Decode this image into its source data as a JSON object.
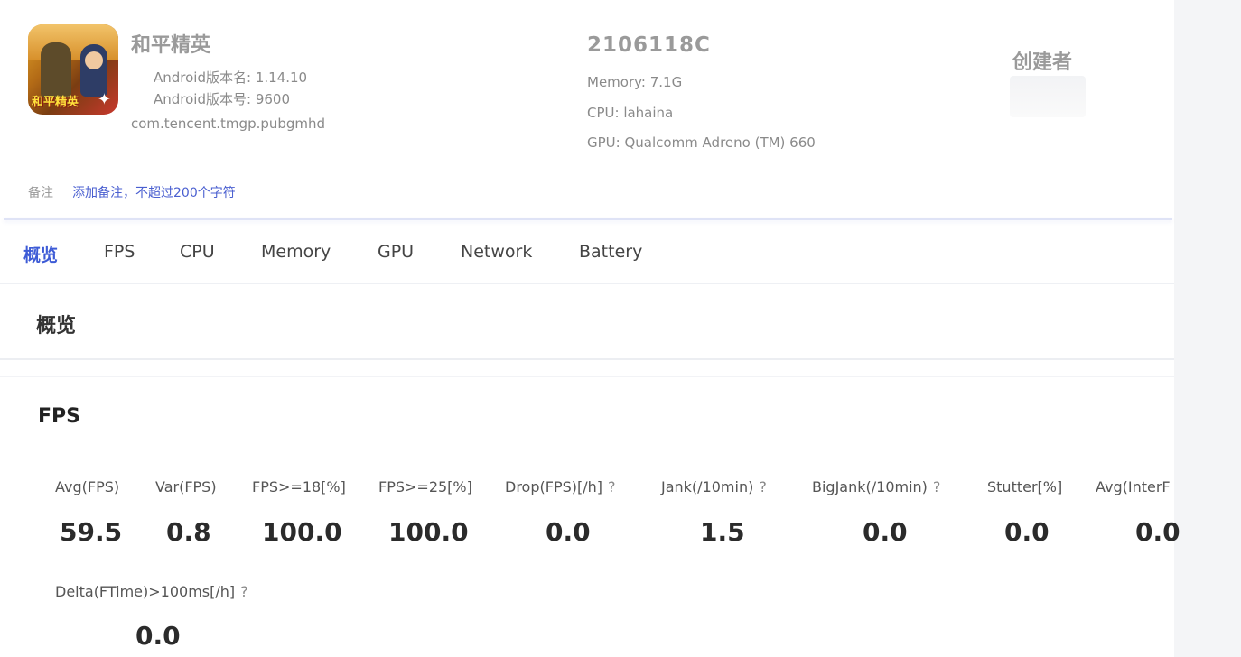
{
  "app": {
    "name": "和平精英",
    "version_name": "Android版本名: 1.14.10",
    "version_code": "Android版本号: 9600",
    "package": "com.tencent.tmgp.pubgmhd",
    "icon_badge": "和平精英"
  },
  "device": {
    "model": "2106118C",
    "memory": "Memory: 7.1G",
    "cpu": "CPU: lahaina",
    "gpu": "GPU: Qualcomm Adreno (TM) 660"
  },
  "creator": {
    "label": "创建者"
  },
  "remark": {
    "label": "备注",
    "link": "添加备注，不超过200个字符"
  },
  "tabs": [
    "概览",
    "FPS",
    "CPU",
    "Memory",
    "GPU",
    "Network",
    "Battery"
  ],
  "active_tab": "概览",
  "overview": {
    "title": "概览"
  },
  "fps": {
    "title": "FPS",
    "help_symbol": "?",
    "metrics": [
      {
        "label": "Avg(FPS)",
        "value": "59.5"
      },
      {
        "label": "Var(FPS)",
        "value": "0.8"
      },
      {
        "label": "FPS>=18[%]",
        "value": "100.0"
      },
      {
        "label": "FPS>=25[%]",
        "value": "100.0"
      },
      {
        "label": "Drop(FPS)[/h]",
        "value": "0.0"
      },
      {
        "label": "Jank(/10min)",
        "value": "1.5"
      },
      {
        "label": "BigJank(/10min)",
        "value": "0.0"
      },
      {
        "label": "Stutter[%]",
        "value": "0.0"
      },
      {
        "label": "Avg(InterF",
        "value": "0.0"
      },
      {
        "label": "Delta(FTime)>100ms[/h]",
        "value": "0.0"
      }
    ]
  },
  "colors": {
    "accent": "#3d5bd6",
    "link": "#4a5fd0"
  }
}
